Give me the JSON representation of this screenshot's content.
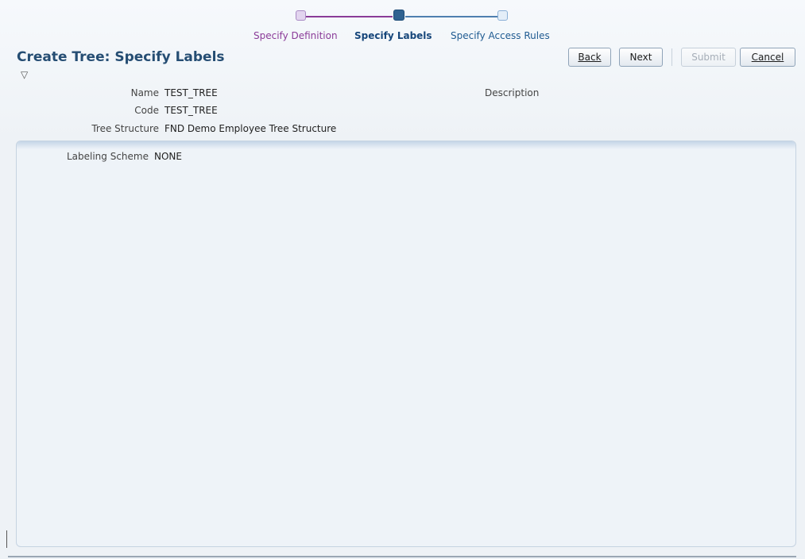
{
  "train": {
    "steps": [
      {
        "label": "Specify Definition",
        "state": "visited"
      },
      {
        "label": "Specify Labels",
        "state": "current"
      },
      {
        "label": "Specify Access Rules",
        "state": "unvisited"
      }
    ]
  },
  "header": {
    "title": "Create Tree: Specify Labels",
    "disclosure_icon": "▽"
  },
  "buttons": {
    "back": "Back",
    "next": "Next",
    "submit": "Submit",
    "cancel": "Cancel"
  },
  "fields": {
    "name_label": "Name",
    "name_value": "TEST_TREE",
    "code_label": "Code",
    "code_value": "TEST_TREE",
    "tree_structure_label": "Tree Structure",
    "tree_structure_value": "FND Demo Employee Tree Structure",
    "description_label": "Description"
  },
  "panel": {
    "labeling_scheme_label": "Labeling Scheme",
    "labeling_scheme_value": "NONE"
  },
  "colors": {
    "title": "#254d73",
    "visited_step": "#8a3b98",
    "current_step": "#16467a"
  }
}
